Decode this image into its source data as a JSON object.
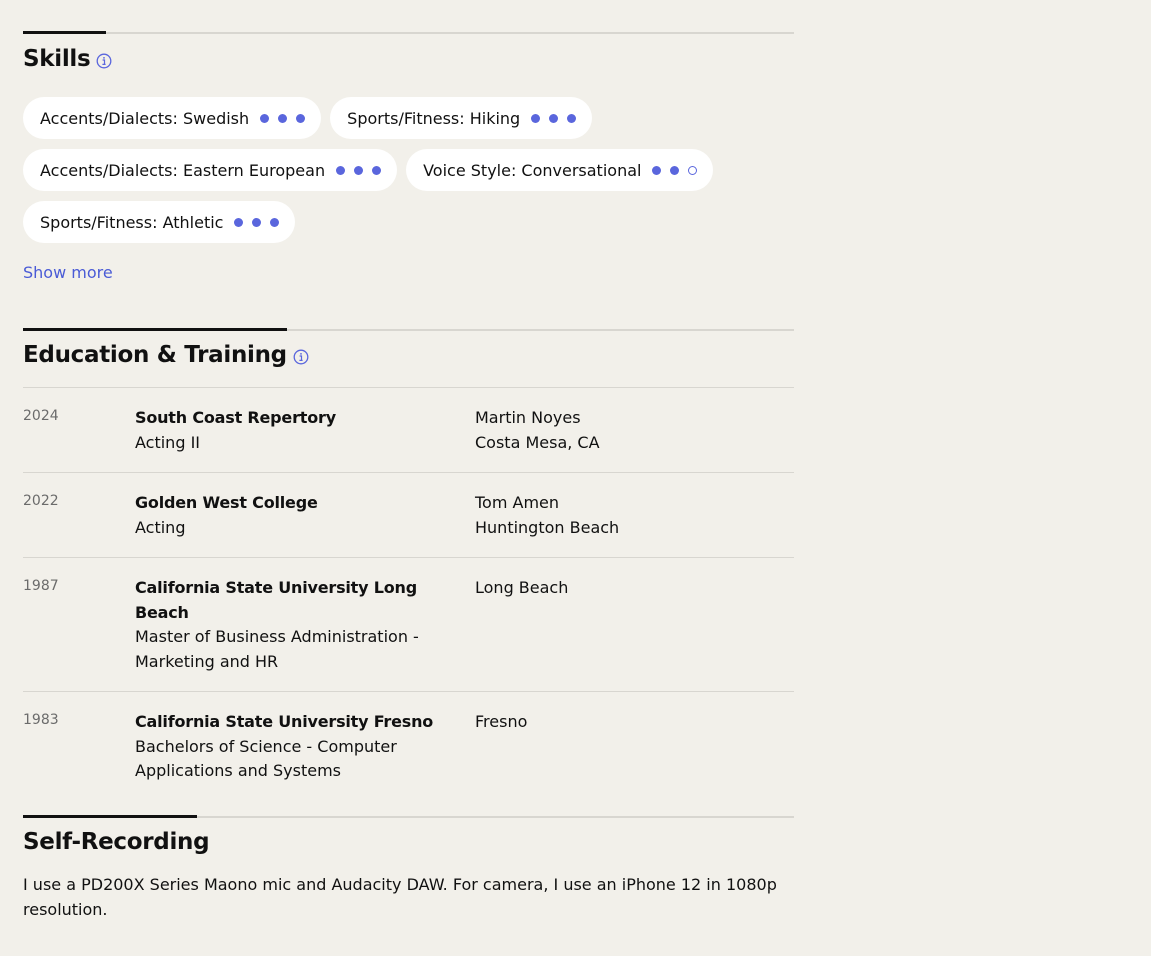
{
  "skills": {
    "title": "Skills",
    "items": [
      {
        "label": "Accents/Dialects: Swedish",
        "level": 3,
        "max": 3
      },
      {
        "label": "Sports/Fitness: Hiking",
        "level": 3,
        "max": 3
      },
      {
        "label": "Accents/Dialects: Eastern European",
        "level": 3,
        "max": 3
      },
      {
        "label": "Voice Style: Conversational",
        "level": 2,
        "max": 3
      },
      {
        "label": "Sports/Fitness: Athletic",
        "level": 3,
        "max": 3
      }
    ],
    "show_more_label": "Show more"
  },
  "education": {
    "title": "Education & Training",
    "rows": [
      {
        "year": "2024",
        "school": "South Coast Repertory",
        "program": "Acting II",
        "instructor": "Martin Noyes",
        "location": "Costa Mesa, CA"
      },
      {
        "year": "2022",
        "school": "Golden West College",
        "program": "Acting",
        "instructor": "Tom Amen",
        "location": "Huntington Beach"
      },
      {
        "year": "1987",
        "school": "California State University Long Beach",
        "program": "Master of Business Administration - Marketing and HR",
        "instructor": "Long Beach",
        "location": ""
      },
      {
        "year": "1983",
        "school": "California State University Fresno",
        "program": "Bachelors of Science - Computer Applications and Systems",
        "instructor": "Fresno",
        "location": ""
      }
    ]
  },
  "self_recording": {
    "title": "Self-Recording",
    "text": "I use a PD200X Series Maono mic and Audacity DAW. For camera, I use an iPhone 12 in 1080p resolution."
  },
  "colors": {
    "accent": "#5a66dd",
    "link": "#4a5bd6",
    "background": "#f2f0ea",
    "chip": "#ffffff"
  },
  "icons": {
    "info": "info-circle-icon"
  }
}
